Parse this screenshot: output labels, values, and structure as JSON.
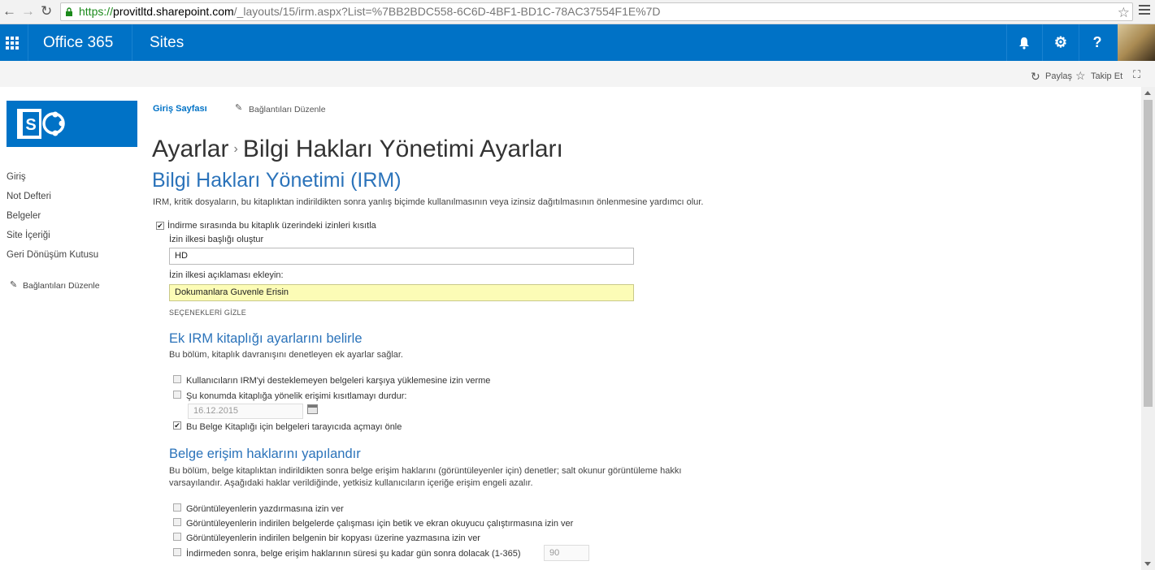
{
  "browser": {
    "url_scheme": "https://",
    "url_host": "provitltd.sharepoint.com",
    "url_rest": "/_layouts/15/irm.aspx?List=%7BB2BDC558-6C6D-4BF1-BD1C-78AC37554F1E%7D",
    "back_icon": "back-arrow-icon",
    "forward_icon": "forward-arrow-icon",
    "reload_icon": "reload-icon"
  },
  "suitebar": {
    "brand": "Office 365",
    "section": "Sites",
    "bell": "🔔",
    "gear": "⚙",
    "help": "?",
    "color": "#0072c6"
  },
  "sharebar": {
    "share": "Paylaş",
    "follow": "Takip Et"
  },
  "leftnav": {
    "items": [
      "Giriş",
      "Not Defteri",
      "Belgeler",
      "Site İçeriği",
      "Geri Dönüşüm Kutusu"
    ],
    "edit_links": "Bağlantıları Düzenle"
  },
  "breadcrumb": {
    "home": "Giriş Sayfası",
    "edit_links": "Bağlantıları Düzenle"
  },
  "page": {
    "title_part1": "Ayarlar",
    "title_sep": "›",
    "title_part2": "Bilgi Hakları Yönetimi Ayarları"
  },
  "irm": {
    "heading": "Bilgi Hakları Yönetimi (IRM)",
    "description": "IRM, kritik dosyaların, bu kitaplıktan indirildikten sonra yanlış biçimde kullanılmasının veya izinsiz dağıtılmasının önlenmesine yardımcı olur.",
    "restrict_label": "İndirme sırasında bu kitaplık üzerindeki izinleri kısıtla",
    "restrict_checked": true,
    "policy_title_label": "İzin ilkesi başlığı oluştur",
    "policy_title_value": "HD",
    "policy_desc_label": "İzin ilkesi açıklaması ekleyin:",
    "policy_desc_value": "Dokumanlara Guvenle Erisin",
    "hide_options": "SEÇENEKLERİ GİZLE"
  },
  "extra_settings": {
    "heading": "Ek IRM kitaplığı ayarlarını belirle",
    "description": "Bu bölüm, kitaplık davranışını denetleyen ek ayarlar sağlar.",
    "options": [
      {
        "label": "Kullanıcıların IRM'yi desteklemeyen belgeleri karşıya yüklemesine izin verme",
        "checked": false
      },
      {
        "label": "Şu konumda kitaplığa yönelik erişimi kısıtlamayı durdur:",
        "checked": false
      },
      {
        "label": "Bu Belge Kitaplığı için belgeleri tarayıcıda açmayı önle",
        "checked": true
      }
    ],
    "date_value": "16.12.2015"
  },
  "access_rights": {
    "heading": "Belge erişim haklarını yapılandır",
    "description_line1": "Bu bölüm, belge kitaplıktan indirildikten sonra belge erişim haklarını (görüntüleyenler için) denetler; salt okunur görüntüleme hakkı",
    "description_line2": "varsayılandır. Aşağıdaki haklar verildiğinde, yetkisiz kullanıcıların içeriğe erişim engeli azalır.",
    "options": [
      {
        "label": "Görüntüleyenlerin yazdırmasına izin ver",
        "checked": false
      },
      {
        "label": "Görüntüleyenlerin indirilen belgelerde çalışması için betik ve ekran okuyucu çalıştırmasına izin ver",
        "checked": false
      },
      {
        "label": "Görüntüleyenlerin indirilen belgenin bir kopyası üzerine yazmasına izin ver",
        "checked": false
      },
      {
        "label": "İndirmeden sonra, belge erişim haklarının süresi şu kadar gün sonra dolacak (1-365)",
        "checked": false
      }
    ],
    "days_value": "90"
  }
}
